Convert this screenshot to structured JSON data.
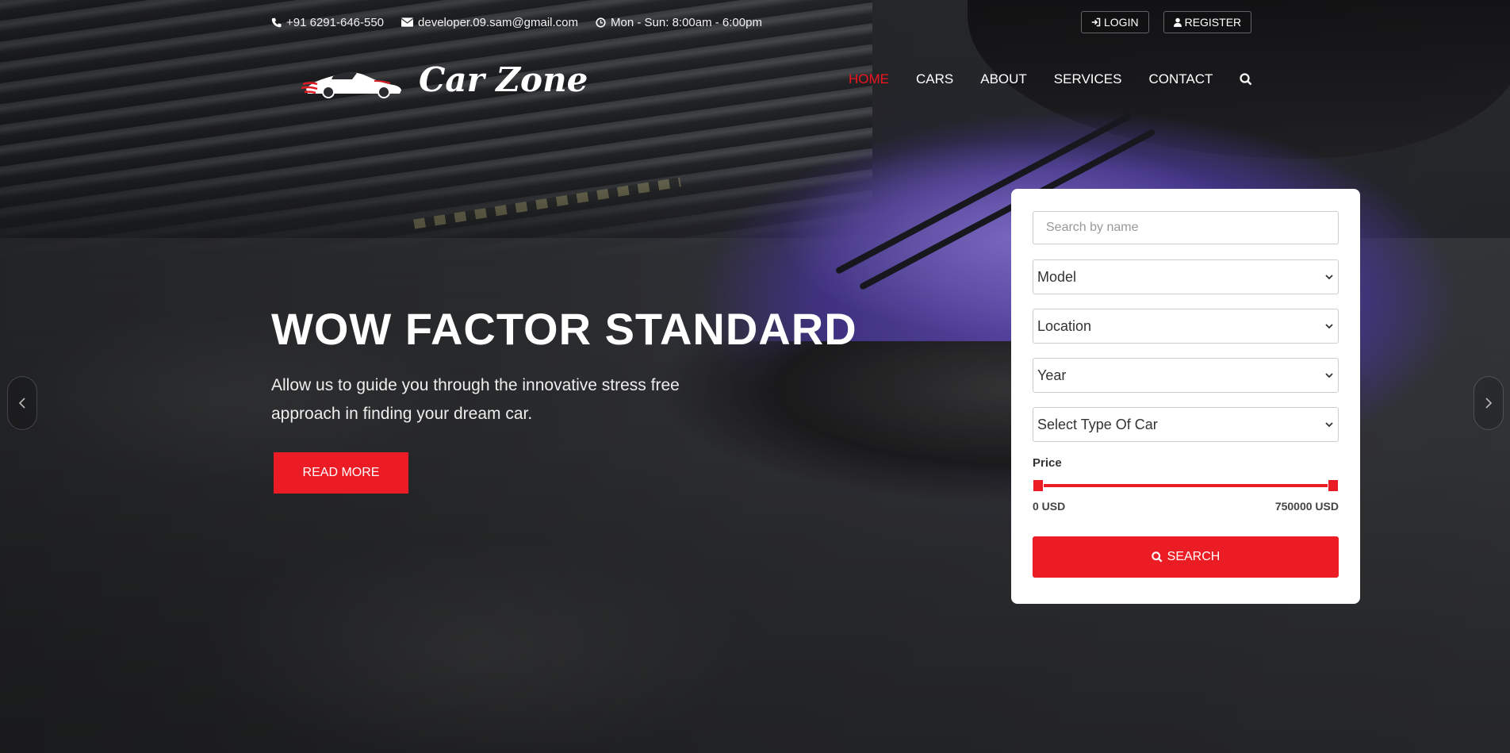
{
  "topbar": {
    "phone": "+91 6291-646-550",
    "email": "developer.09.sam@gmail.com",
    "hours": "Mon - Sun: 8:00am - 6:00pm"
  },
  "auth": {
    "login": "LOGIN",
    "register": "REGISTER"
  },
  "brand": {
    "name": "Car Zone"
  },
  "nav": {
    "items": [
      "HOME",
      "CARS",
      "ABOUT",
      "SERVICES",
      "CONTACT"
    ],
    "active": "HOME"
  },
  "hero": {
    "title": "WOW FACTOR STANDARD",
    "subtitle": "Allow us to guide you through the innovative stress free approach in finding your dream car.",
    "button": "READ MORE"
  },
  "search_panel": {
    "search_placeholder": "Search by name",
    "model": "Model",
    "location": "Location",
    "year": "Year",
    "car_type": "Select Type Of Car",
    "price_label": "Price",
    "price_min": "0 USD",
    "price_max": "750000 USD",
    "price_min_fraction": 0,
    "price_max_fraction": 1,
    "search_button": "SEARCH"
  },
  "colors": {
    "accent": "#ec1c24",
    "panel": "#ffffff"
  },
  "icons": [
    "phone-icon",
    "envelope-icon",
    "clock-icon",
    "sign-in-icon",
    "user-icon",
    "search-icon",
    "chevron-left-icon",
    "chevron-right-icon",
    "chevron-down-icon"
  ]
}
